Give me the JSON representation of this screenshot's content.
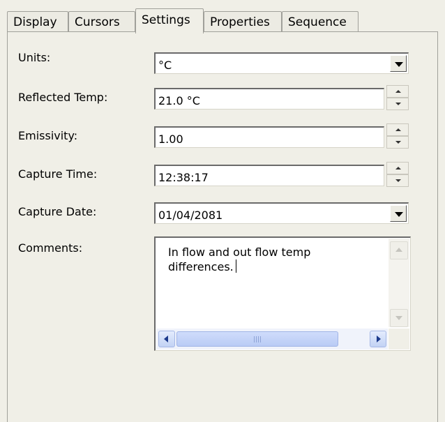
{
  "tabs": [
    {
      "label": "Display",
      "active": false
    },
    {
      "label": "Cursors",
      "active": false
    },
    {
      "label": "Settings",
      "active": true
    },
    {
      "label": "Properties",
      "active": false
    },
    {
      "label": "Sequence",
      "active": false
    }
  ],
  "settings": {
    "units": {
      "label": "Units:",
      "value": "°C"
    },
    "reflected_temp": {
      "label": "Reflected Temp:",
      "value": "21.0 °C"
    },
    "emissivity": {
      "label": "Emissivity:",
      "value": "1.00"
    },
    "capture_time": {
      "label": "Capture Time:",
      "value": "12:38:17"
    },
    "capture_date": {
      "label": "Capture Date:",
      "value": "01/04/2081"
    },
    "comments": {
      "label": "Comments:",
      "value": "In flow and out flow temp\ndifferences."
    }
  },
  "colors": {
    "panel_bg": "#f0efe7",
    "scrollbar_accent": "#c2d2f4",
    "border": "#a0a09a"
  },
  "icons": [
    "dropdown-arrow-icon",
    "spin-up-icon",
    "spin-down-icon",
    "scroll-left-icon",
    "scroll-right-icon",
    "scroll-up-icon",
    "scroll-down-icon"
  ]
}
